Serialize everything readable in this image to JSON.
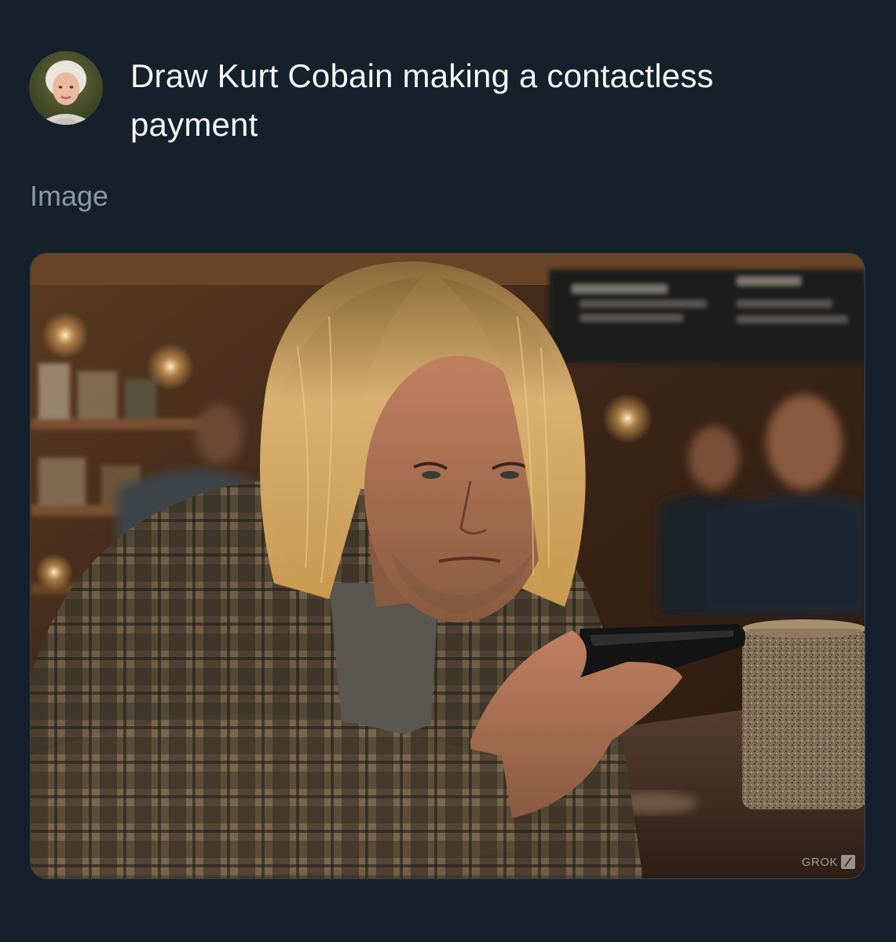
{
  "post": {
    "avatar_icon": "user-avatar",
    "prompt_text": "Draw Kurt Cobain making a contactless payment",
    "section_label": "Image"
  },
  "generated_image": {
    "watermark": "GROK",
    "watermark_icon": "grok-logo-icon"
  },
  "colors": {
    "background": "#15202b",
    "text_primary": "#f7f9f9",
    "text_secondary": "#8b98a5",
    "card_border": "#38444d"
  }
}
